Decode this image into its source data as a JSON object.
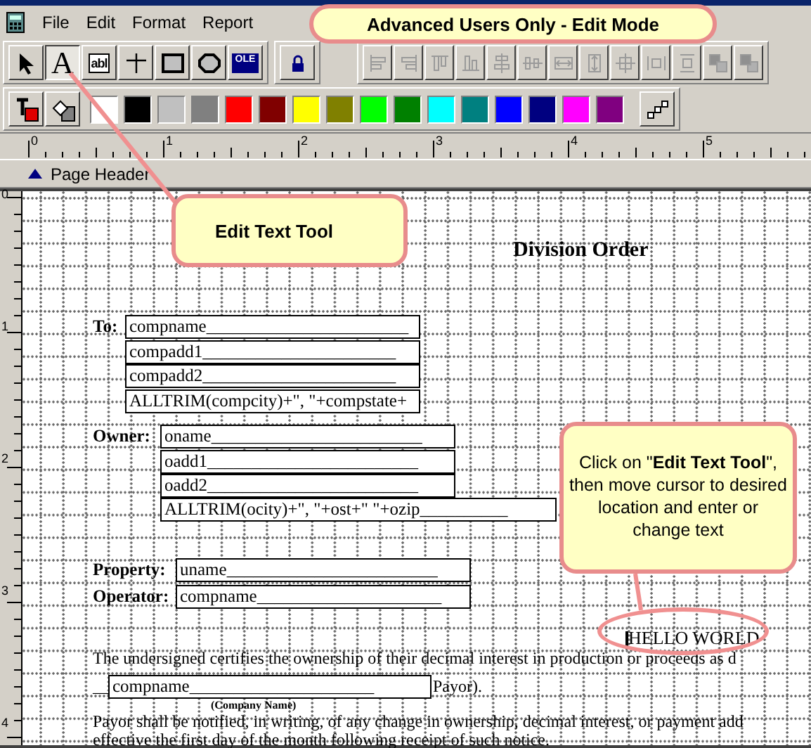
{
  "menu": [
    {
      "label": "File"
    },
    {
      "label": "Edit"
    },
    {
      "label": "Format"
    },
    {
      "label": "Report"
    }
  ],
  "mode_callout": {
    "text": "Advanced Users Only - Edit Mode"
  },
  "tools": [
    {
      "kind": "pointer",
      "selected": false
    },
    {
      "kind": "text",
      "label": "A",
      "selected": true
    },
    {
      "kind": "field",
      "label": "abl",
      "selected": false
    },
    {
      "kind": "line",
      "selected": false
    },
    {
      "kind": "rectangle",
      "selected": false
    },
    {
      "kind": "rounded",
      "selected": false
    },
    {
      "kind": "ole",
      "label": "OLE",
      "selected": false
    },
    {
      "kind": "lock",
      "selected": false
    }
  ],
  "align_tools": [
    {
      "kind": "align-left",
      "disabled": true
    },
    {
      "kind": "align-right",
      "disabled": true
    },
    {
      "kind": "align-top",
      "disabled": true
    },
    {
      "kind": "align-bottom",
      "disabled": true
    },
    {
      "kind": "center-vertical",
      "disabled": true
    },
    {
      "kind": "center-horizontal",
      "disabled": true
    },
    {
      "kind": "same-width",
      "disabled": true
    },
    {
      "kind": "same-height",
      "disabled": true
    },
    {
      "kind": "center-both",
      "disabled": true
    },
    {
      "kind": "space-horizontal",
      "disabled": true
    },
    {
      "kind": "space-vertical",
      "disabled": true
    },
    {
      "kind": "bring-front",
      "disabled": true
    },
    {
      "kind": "send-back",
      "disabled": true
    }
  ],
  "palette": [
    {
      "color": "#ffffff"
    },
    {
      "color": "#000000"
    },
    {
      "color": "#c0c0c0"
    },
    {
      "color": "#808080"
    },
    {
      "color": "#ff0000"
    },
    {
      "color": "#800000"
    },
    {
      "color": "#ffff00"
    },
    {
      "color": "#808000"
    },
    {
      "color": "#00ff00"
    },
    {
      "color": "#008000"
    },
    {
      "color": "#00ffff"
    },
    {
      "color": "#008080"
    },
    {
      "color": "#0000ff"
    },
    {
      "color": "#000080"
    },
    {
      "color": "#ff00ff"
    },
    {
      "color": "#800080"
    }
  ],
  "ruler": {
    "labels": [
      "0",
      "1",
      "2",
      "3",
      "4",
      "5"
    ]
  },
  "vertical_ruler": {
    "labels": [
      "0",
      "1",
      "2",
      "3",
      "4"
    ]
  },
  "band": {
    "label": "Page Header"
  },
  "callouts": [
    {
      "kind": "label",
      "text": "Edit Text Tool"
    },
    {
      "kind": "note",
      "text": "Click on \"**Edit Text Tool**\", then move cursor to desired location and enter or change text"
    }
  ],
  "report": [
    {
      "kind": "title",
      "text": "Division Order"
    },
    {
      "kind": "label",
      "text": "To:"
    },
    {
      "kind": "field",
      "text": "compname_______________________"
    },
    {
      "kind": "field",
      "text": "compadd1______________________"
    },
    {
      "kind": "field",
      "text": "compadd2______________________"
    },
    {
      "kind": "field",
      "text": "ALLTRIM(compcity)+\", \"+compstate+"
    },
    {
      "kind": "label",
      "text": "Owner:"
    },
    {
      "kind": "field",
      "text": "oname________________________"
    },
    {
      "kind": "field",
      "text": "oadd1________________________"
    },
    {
      "kind": "field",
      "text": "oadd2________________________"
    },
    {
      "kind": "field",
      "text": "ALLTRIM(ocity)+\", \"+ost+\" \"+ozip__________"
    },
    {
      "kind": "label",
      "text": "Property:"
    },
    {
      "kind": "field",
      "text": "uname________________________"
    },
    {
      "kind": "label",
      "text": "Operator:"
    },
    {
      "kind": "field",
      "text": "compname_____________________"
    },
    {
      "kind": "typed",
      "text": "HELLO WORLD"
    },
    {
      "kind": "text",
      "text": "The undersigned certifies the ownership of their decimal interest in production or proceeds as d"
    },
    {
      "kind": "text",
      "text": "__"
    },
    {
      "kind": "field",
      "text": "compname_____________________"
    },
    {
      "kind": "text",
      "text": "Payor)."
    },
    {
      "kind": "caption",
      "text": "(Company Name)"
    },
    {
      "kind": "text",
      "text": "Payor shall be notified, in writing, of any change in ownership, decimal interest, or payment add"
    },
    {
      "kind": "text",
      "text": "effective the first day of the month following receipt of such notice."
    }
  ]
}
